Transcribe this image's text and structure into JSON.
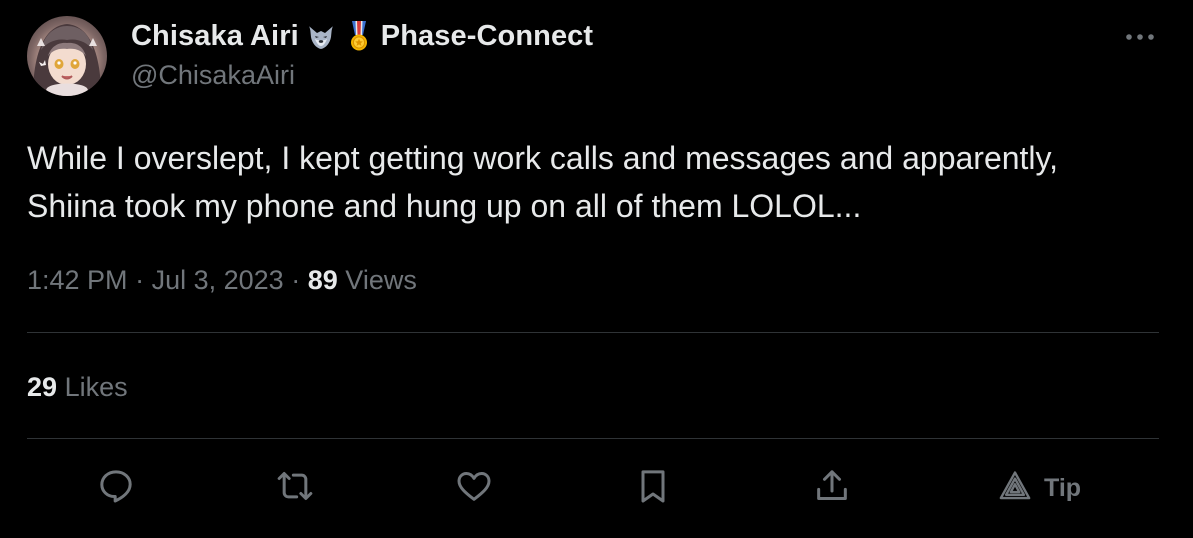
{
  "author": {
    "display_name": "Chisaka Airi",
    "name_suffix": "Phase-Connect",
    "handle": "@ChisakaAiri",
    "emojis": [
      "wolf-face",
      "military-medal"
    ]
  },
  "tweet": {
    "text_lines": [
      "While I overslept, I kept getting work calls and messages and apparently,",
      "Shiina took my phone and hung up on all of them LOLOL..."
    ],
    "time": "1:42 PM",
    "date": "Jul 3, 2023",
    "separator": "·",
    "views_count": "89",
    "views_label": "Views"
  },
  "stats": {
    "likes_count": "29",
    "likes_label": "Likes"
  },
  "actions": {
    "icons": [
      "reply-icon",
      "retweet-icon",
      "like-icon",
      "bookmark-icon",
      "share-icon",
      "tip-icon"
    ],
    "tip_label": "Tip"
  },
  "colors": {
    "background": "#000000",
    "text_primary": "#e7e9ea",
    "text_secondary": "#71767b",
    "divider": "#2f3336"
  }
}
